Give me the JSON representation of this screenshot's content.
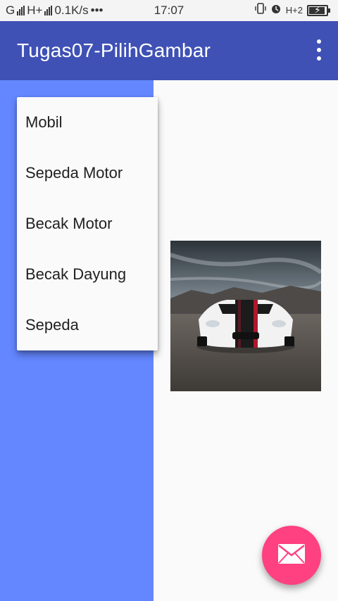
{
  "status_bar": {
    "network_type": "H+",
    "speed": "0.1K/s",
    "dots": "•••",
    "time": "17:07",
    "h2_label": "H+2"
  },
  "app_bar": {
    "title": "Tugas07-PilihGambar",
    "color": "#3f51b5"
  },
  "left_panel": {
    "color": "#6487ff"
  },
  "dropdown": {
    "items": [
      {
        "label": "Mobil"
      },
      {
        "label": "Sepeda Motor"
      },
      {
        "label": "Becak Motor"
      },
      {
        "label": "Becak Dayung"
      },
      {
        "label": "Sepeda"
      }
    ]
  },
  "image": {
    "subject": "sports-car-photo"
  },
  "fab": {
    "icon": "mail-icon",
    "color": "#ff4081"
  }
}
